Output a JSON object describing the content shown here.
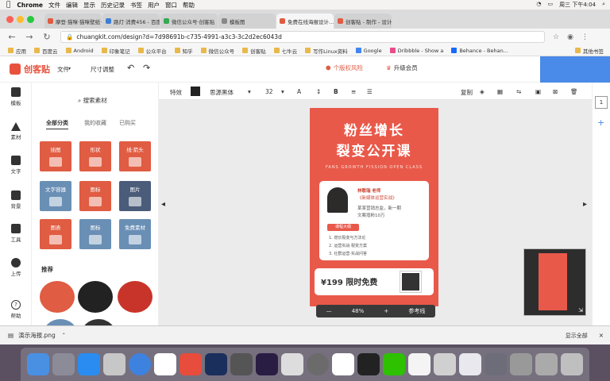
{
  "menubar": {
    "app": "Chrome",
    "items": [
      "文件",
      "编辑",
      "显示",
      "历史记录",
      "书签",
      "用户",
      "窗口",
      "帮助"
    ],
    "clock": "周三 下午4:04"
  },
  "tabs": [
    {
      "label": "摩登·猫咪·猫咪壁纸·...",
      "color": "#e05c42"
    },
    {
      "label": "路灯·消费456 - 百度...",
      "color": "#3b7dd8"
    },
    {
      "label": "微信公众号·创客贴",
      "color": "#34a853"
    },
    {
      "label": "模板图",
      "color": "#888888"
    },
    {
      "label": "免费在线海报设计...",
      "color": "#e05c42",
      "active": true
    },
    {
      "label": "创客贴 - 制作 - 设计页",
      "color": "#e05c42"
    }
  ],
  "address": {
    "url": "chuangkit.com/design?d=7d98691b-c735-4991-a3c3-3c2d2ec6043d"
  },
  "bookmarks": [
    "应用",
    "百度云",
    "Android",
    "印象笔记",
    "公众平台",
    "知乎",
    "微信公众号",
    "创客贴",
    "七牛云",
    "写作Linux资料",
    "Google",
    "Dribbble - Show a",
    "Behance - Behan...",
    "其他书签"
  ],
  "apphead": {
    "logo": "创客贴",
    "menu_file": "文件",
    "menu_size": "尺寸调整",
    "upgrade_personal": "个版权风险",
    "upgrade_member": "升级会员"
  },
  "sidebar": [
    {
      "label": "模板"
    },
    {
      "label": "素材"
    },
    {
      "label": "文字"
    },
    {
      "label": "背景"
    },
    {
      "label": "工具"
    },
    {
      "label": "上传"
    },
    {
      "label": "帮助"
    }
  ],
  "panel": {
    "search": "搜索素材",
    "cats": [
      "全部分类",
      "我的收藏",
      "已购买"
    ],
    "tiles": [
      {
        "label": "插图",
        "color": "#e05c42"
      },
      {
        "label": "形状",
        "color": "#e05c42"
      },
      {
        "label": "线·箭头",
        "color": "#e05c42"
      },
      {
        "label": "文字容器",
        "color": "#6a8fb5"
      },
      {
        "label": "图标",
        "color": "#e05c42"
      },
      {
        "label": "图片",
        "color": "#4a5c7a"
      },
      {
        "label": "图表",
        "color": "#e05c42"
      },
      {
        "label": "图标",
        "color": "#6a8fb5"
      },
      {
        "label": "免费素材",
        "color": "#6a8fb5"
      }
    ],
    "recommend": "推荐"
  },
  "toolbar": {
    "effect": "特效",
    "font": "思源黑体",
    "size": "32",
    "copy": "复制"
  },
  "poster": {
    "title1": "粉丝增长",
    "title2": "裂变公开课",
    "subtitle": "FANS GROWTH FISSION OPEN CLASS",
    "name": "林歌瑞  老师",
    "role": "《新媒体运营实战》",
    "line1": "某某营销总监，新一期",
    "line2": "文案增粉10万",
    "tag": "课程大纲",
    "points": [
      "1. 增长裂变与方法论",
      "2. 运营实战·裂变方案",
      "3. 社群运营·实战问答"
    ],
    "price": "¥199 限时免费"
  },
  "zoom": {
    "minus": "—",
    "value": "48%",
    "plus": "+",
    "fit": "参考线"
  },
  "page": {
    "num": "1"
  },
  "download": {
    "file": "演示海报.png",
    "showall": "显示全部"
  }
}
